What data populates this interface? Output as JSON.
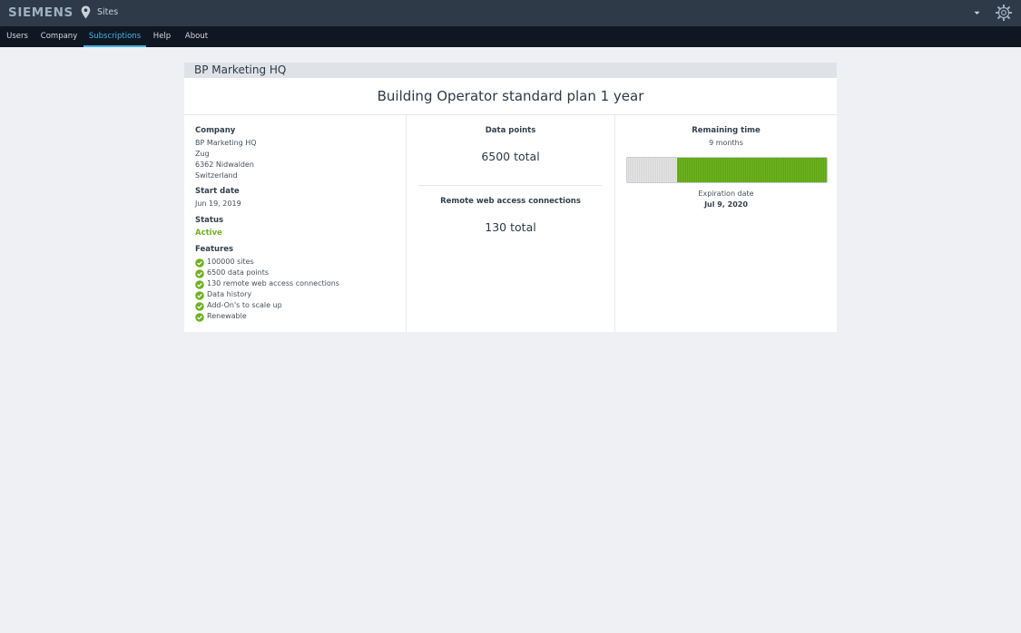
{
  "header": {
    "brand": "SIEMENS",
    "location_label": "Sites",
    "icons": [
      "map-pin-icon",
      "chevron-down-icon",
      "gear-icon"
    ]
  },
  "nav": {
    "tabs": [
      {
        "label": "Users",
        "active": false
      },
      {
        "label": "Company",
        "active": false
      },
      {
        "label": "Subscriptions",
        "active": true
      },
      {
        "label": "Help",
        "active": false
      },
      {
        "label": "About",
        "active": false
      }
    ]
  },
  "subscription": {
    "site_name": "BP Marketing HQ",
    "plan_title": "Building Operator standard plan 1 year",
    "company": {
      "label": "Company",
      "lines": [
        "BP Marketing HQ",
        "Zug",
        "6362 Nidwalden",
        "Switzerland"
      ]
    },
    "start_date": {
      "label": "Start date",
      "value": "Jun 19, 2019"
    },
    "status": {
      "label": "Status",
      "value": "Active"
    },
    "features": {
      "label": "Features",
      "items": [
        "100000 sites",
        "6500 data points",
        "130 remote web access connections",
        "Data history",
        "Add-On's to scale up",
        "Renewable"
      ]
    },
    "data_points": {
      "label": "Data points",
      "value": "6500 total"
    },
    "remote_connections": {
      "label": "Remote web access connections",
      "value": "130 total"
    },
    "remaining_time": {
      "label": "Remaining time",
      "value": "9 months",
      "fraction_remaining": 0.75
    },
    "expiration": {
      "label": "Expiration date",
      "value": "Jul 9, 2020"
    }
  },
  "colors": {
    "accent": "#41b3e6",
    "active_green": "#6fb21e",
    "topbar": "#2e3a48",
    "navbar": "#0f1722"
  }
}
